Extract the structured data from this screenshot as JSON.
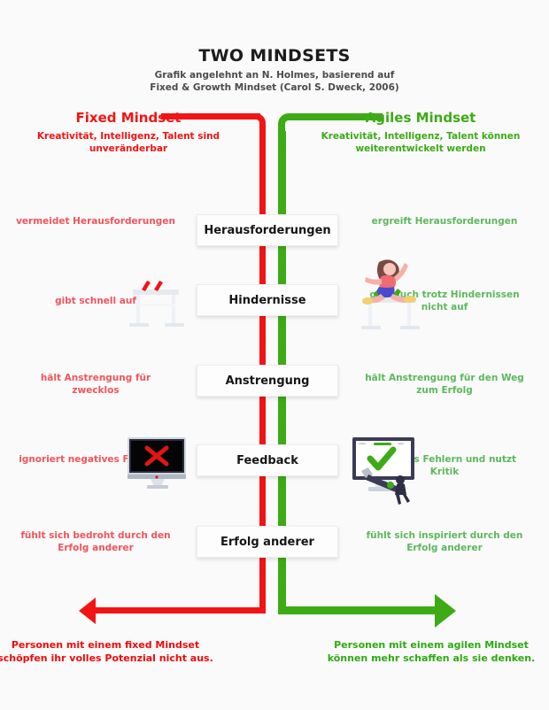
{
  "header": {
    "title": "TWO MINDSETS",
    "subtitle": "Grafik angelehnt an N. Holmes, basierend auf Fixed & Growth Mindset (Carol S. Dweck, 2006)"
  },
  "columns": {
    "left": {
      "heading": "Fixed Mindset",
      "subheading": "Kreativität, Intelligenz, Talent sind unveränderbar",
      "color": "#f21414",
      "caption_color": "#f2545b",
      "conclusion": "Personen mit einem fixed Mindset schöpfen ihr volles Potenzial nicht aus."
    },
    "right": {
      "heading": "Agiles Mindset",
      "subheading": "Kreativität, Intelligenz, Talent können weiterentwickelt werden",
      "color": "#3dab16",
      "caption_color": "#5cb85c",
      "conclusion": "Personen mit einem agilen Mindset können mehr schaffen als sie denken."
    }
  },
  "rows": [
    {
      "label": "Herausforderungen",
      "left_caption": "vermeidet Herausforderungen",
      "right_caption": "ergreift Herausforderungen"
    },
    {
      "label": "Hindernisse",
      "left_caption": "gibt schnell auf",
      "right_caption": "gibt auch trotz Hindernissen nicht auf"
    },
    {
      "label": "Anstrengung",
      "left_caption": "hält Anstrengung für zwecklos",
      "right_caption": "hält Anstrengung für den Weg zum Erfolg"
    },
    {
      "label": "Feedback",
      "left_caption": "ignoriert negatives Feedback",
      "right_caption": "lernt aus Fehlern und nutzt Kritik"
    },
    {
      "label": "Erfolg anderer",
      "left_caption": "fühlt sich bedroht durch den Erfolg anderer",
      "right_caption": "fühlt sich inspiriert durch den Erfolg anderer"
    }
  ],
  "icons": {
    "hurdle_plain": "hurdle-icon",
    "hurdle_runner": "runner-jumping-hurdle-icon",
    "monitor_x": "monitor-red-x-icon",
    "monitor_check": "monitor-green-check-icon",
    "arrow_left": "arrow-left-icon",
    "arrow_right": "arrow-right-icon"
  }
}
